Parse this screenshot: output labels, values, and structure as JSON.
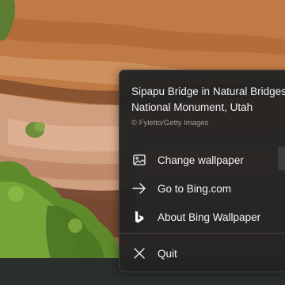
{
  "wallpaper": {
    "subject": "sandstone-cliff-with-green-shrubs"
  },
  "flyout": {
    "title": "Sipapu Bridge in Natural Bridges National Monument, Utah",
    "title_line_1": "Sipapu Bridge in Natural Bridges",
    "title_line_2": "National Monument, Utah",
    "credit": "© Fyletto/Getty Images",
    "items": [
      {
        "label": "Change wallpaper",
        "icon": "image-icon"
      },
      {
        "label": "Go to Bing.com",
        "icon": "arrow-right-icon"
      },
      {
        "label": "About Bing Wallpaper",
        "icon": "bing-logo-icon"
      },
      {
        "label": "Quit",
        "icon": "close-icon"
      }
    ]
  },
  "colors": {
    "menu_background": "#222222",
    "menu_text": "#f4f4f4",
    "credit_text": "#9d9d9d",
    "divider": "#474747"
  }
}
